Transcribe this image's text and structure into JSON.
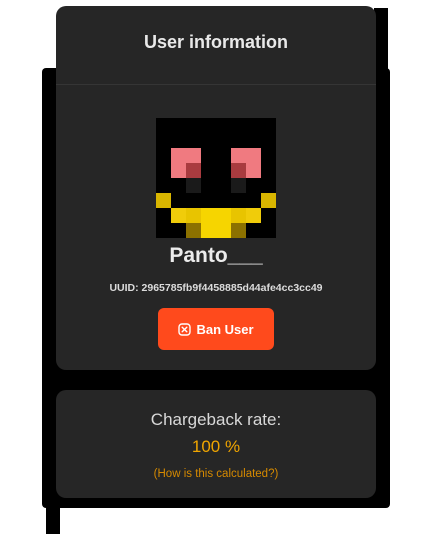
{
  "user_card": {
    "title": "User information",
    "username": "Panto___",
    "uuid": "UUID: 2965785fb9f4458885d44afe4cc3cc49",
    "ban_button": {
      "label": "Ban User",
      "icon": "close-square-icon"
    }
  },
  "chargeback_card": {
    "label": "Chargeback rate:",
    "value": "100 %",
    "link_text": "(How is this calculated?)"
  },
  "colors": {
    "card_background": "#262626",
    "danger_button": "#ff4a1c",
    "accent_orange": "#f0a500"
  }
}
